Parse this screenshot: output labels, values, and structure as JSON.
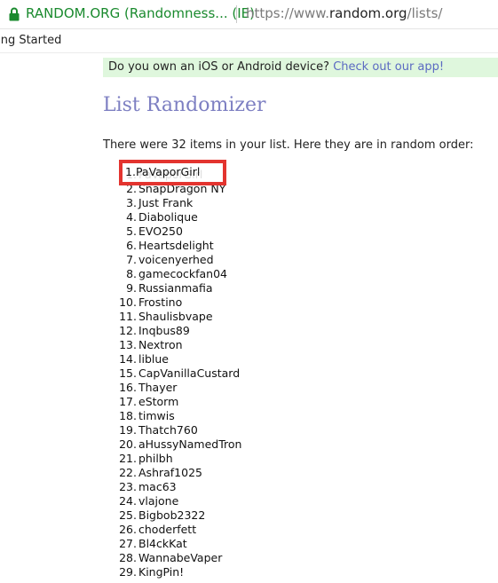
{
  "browser": {
    "site_identity": "RANDOM.ORG (Randomness... (IE)",
    "url_prefix": "https://www.",
    "url_domain": "random.org",
    "url_path": "/lists/",
    "bookmark": "ting Started"
  },
  "promo": {
    "text": "Do you own an iOS or Android device? ",
    "link": "Check out our app!"
  },
  "page": {
    "title": "List Randomizer",
    "intro": "There were 32 items in your list. Here they are in random order:"
  },
  "list": {
    "items": [
      {
        "num": "1.",
        "name": "PaVaporGirl"
      },
      {
        "num": "2.",
        "name": "SnapDragon NY"
      },
      {
        "num": "3.",
        "name": "Just Frank"
      },
      {
        "num": "4.",
        "name": "Diabolique"
      },
      {
        "num": "5.",
        "name": "EVO250"
      },
      {
        "num": "6.",
        "name": "Heartsdelight"
      },
      {
        "num": "7.",
        "name": "voicenyerhed"
      },
      {
        "num": "8.",
        "name": "gamecockfan04"
      },
      {
        "num": "9.",
        "name": "Russianmafia"
      },
      {
        "num": "10.",
        "name": "Frostino"
      },
      {
        "num": "11.",
        "name": "Shaulisbvape"
      },
      {
        "num": "12.",
        "name": "Inqbus89"
      },
      {
        "num": "13.",
        "name": "Nextron"
      },
      {
        "num": "14.",
        "name": "liblue"
      },
      {
        "num": "15.",
        "name": "CapVanillaCustard"
      },
      {
        "num": "16.",
        "name": "Thayer"
      },
      {
        "num": "17.",
        "name": "eStorm"
      },
      {
        "num": "18.",
        "name": "timwis"
      },
      {
        "num": "19.",
        "name": "Thatch760"
      },
      {
        "num": "20.",
        "name": "aHussyNamedTron"
      },
      {
        "num": "21.",
        "name": "philbh"
      },
      {
        "num": "22.",
        "name": "Ashraf1025"
      },
      {
        "num": "23.",
        "name": "mac63"
      },
      {
        "num": "24.",
        "name": "vlajone"
      },
      {
        "num": "25.",
        "name": "Bigbob2322"
      },
      {
        "num": "26.",
        "name": "choderfett"
      },
      {
        "num": "27.",
        "name": "Bl4ckKat"
      },
      {
        "num": "28.",
        "name": "WannabeVaper"
      },
      {
        "num": "29.",
        "name": "KingPin!"
      }
    ]
  },
  "colors": {
    "accent": "#e3342f",
    "title": "#7d7fc2",
    "secure": "#1a8a2e"
  }
}
